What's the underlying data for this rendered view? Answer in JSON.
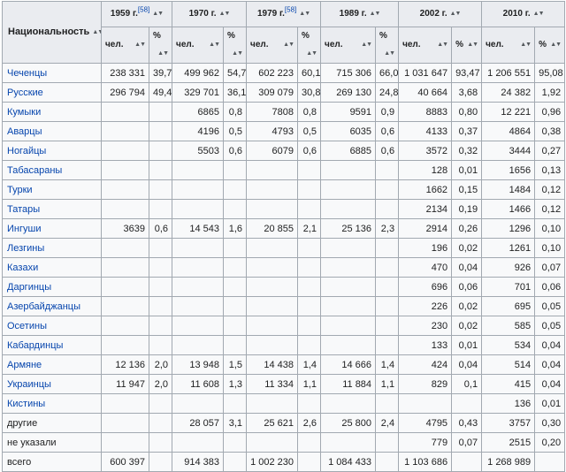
{
  "table": {
    "nationality_header": "Национальность",
    "sort_glyph": "▲▼",
    "years": [
      {
        "label": "1959 г.",
        "ref": "[58]"
      },
      {
        "label": "1970 г.",
        "ref": ""
      },
      {
        "label": "1979 г.",
        "ref": "[58]"
      },
      {
        "label": "1989 г.",
        "ref": ""
      },
      {
        "label": "2002 г.",
        "ref": ""
      },
      {
        "label": "2010 г.",
        "ref": ""
      }
    ],
    "subheaders": {
      "count": "чел.",
      "percent": "%"
    },
    "rows": [
      {
        "name": "Чеченцы",
        "link": true,
        "v": [
          "238 331",
          "39,7",
          "499 962",
          "54,7",
          "602 223",
          "60,1",
          "715 306",
          "66,0",
          "1 031 647",
          "93,47",
          "1 206 551",
          "95,08"
        ]
      },
      {
        "name": "Русские",
        "link": true,
        "v": [
          "296 794",
          "49,4",
          "329 701",
          "36,1",
          "309 079",
          "30,8",
          "269 130",
          "24,8",
          "40 664",
          "3,68",
          "24 382",
          "1,92"
        ]
      },
      {
        "name": "Кумыки",
        "link": true,
        "v": [
          "",
          "",
          "6865",
          "0,8",
          "7808",
          "0,8",
          "9591",
          "0,9",
          "8883",
          "0,80",
          "12 221",
          "0,96"
        ]
      },
      {
        "name": "Аварцы",
        "link": true,
        "v": [
          "",
          "",
          "4196",
          "0,5",
          "4793",
          "0,5",
          "6035",
          "0,6",
          "4133",
          "0,37",
          "4864",
          "0,38"
        ]
      },
      {
        "name": "Ногайцы",
        "link": true,
        "v": [
          "",
          "",
          "5503",
          "0,6",
          "6079",
          "0,6",
          "6885",
          "0,6",
          "3572",
          "0,32",
          "3444",
          "0,27"
        ]
      },
      {
        "name": "Табасараны",
        "link": true,
        "v": [
          "",
          "",
          "",
          "",
          "",
          "",
          "",
          "",
          "128",
          "0,01",
          "1656",
          "0,13"
        ]
      },
      {
        "name": "Турки",
        "link": true,
        "v": [
          "",
          "",
          "",
          "",
          "",
          "",
          "",
          "",
          "1662",
          "0,15",
          "1484",
          "0,12"
        ]
      },
      {
        "name": "Татары",
        "link": true,
        "v": [
          "",
          "",
          "",
          "",
          "",
          "",
          "",
          "",
          "2134",
          "0,19",
          "1466",
          "0,12"
        ]
      },
      {
        "name": "Ингуши",
        "link": true,
        "v": [
          "3639",
          "0,6",
          "14 543",
          "1,6",
          "20 855",
          "2,1",
          "25 136",
          "2,3",
          "2914",
          "0,26",
          "1296",
          "0,10"
        ]
      },
      {
        "name": "Лезгины",
        "link": true,
        "v": [
          "",
          "",
          "",
          "",
          "",
          "",
          "",
          "",
          "196",
          "0,02",
          "1261",
          "0,10"
        ]
      },
      {
        "name": "Казахи",
        "link": true,
        "v": [
          "",
          "",
          "",
          "",
          "",
          "",
          "",
          "",
          "470",
          "0,04",
          "926",
          "0,07"
        ]
      },
      {
        "name": "Даргинцы",
        "link": true,
        "v": [
          "",
          "",
          "",
          "",
          "",
          "",
          "",
          "",
          "696",
          "0,06",
          "701",
          "0,06"
        ]
      },
      {
        "name": "Азербайджанцы",
        "link": true,
        "v": [
          "",
          "",
          "",
          "",
          "",
          "",
          "",
          "",
          "226",
          "0,02",
          "695",
          "0,05"
        ]
      },
      {
        "name": "Осетины",
        "link": true,
        "v": [
          "",
          "",
          "",
          "",
          "",
          "",
          "",
          "",
          "230",
          "0,02",
          "585",
          "0,05"
        ]
      },
      {
        "name": "Кабардинцы",
        "link": true,
        "v": [
          "",
          "",
          "",
          "",
          "",
          "",
          "",
          "",
          "133",
          "0,01",
          "534",
          "0,04"
        ]
      },
      {
        "name": "Армяне",
        "link": true,
        "v": [
          "12 136",
          "2,0",
          "13 948",
          "1,5",
          "14 438",
          "1,4",
          "14 666",
          "1,4",
          "424",
          "0,04",
          "514",
          "0,04"
        ]
      },
      {
        "name": "Украинцы",
        "link": true,
        "v": [
          "11 947",
          "2,0",
          "11 608",
          "1,3",
          "11 334",
          "1,1",
          "11 884",
          "1,1",
          "829",
          "0,1",
          "415",
          "0,04"
        ]
      },
      {
        "name": "Кистины",
        "link": true,
        "v": [
          "",
          "",
          "",
          "",
          "",
          "",
          "",
          "",
          "",
          "",
          "136",
          "0,01"
        ]
      },
      {
        "name": "другие",
        "link": false,
        "v": [
          "",
          "",
          "28 057",
          "3,1",
          "25 621",
          "2,6",
          "25 800",
          "2,4",
          "4795",
          "0,43",
          "3757",
          "0,30"
        ]
      },
      {
        "name": "не указали",
        "link": false,
        "v": [
          "",
          "",
          "",
          "",
          "",
          "",
          "",
          "",
          "779",
          "0,07",
          "2515",
          "0,20"
        ]
      },
      {
        "name": "всего",
        "link": false,
        "v": [
          "600 397",
          "",
          "914 383",
          "",
          "1 002 230",
          "",
          "1 084 433",
          "",
          "1 103 686",
          "",
          "1 268 989",
          ""
        ]
      }
    ]
  }
}
